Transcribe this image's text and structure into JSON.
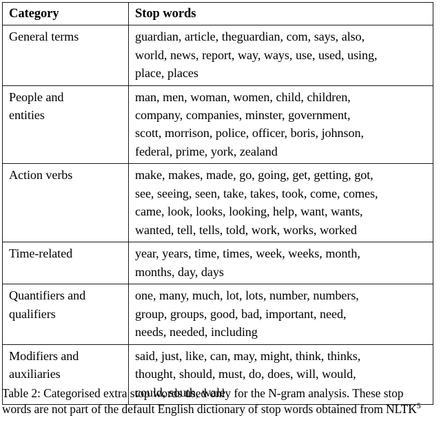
{
  "table": {
    "columns": [
      "Category",
      "Stop words"
    ],
    "rows": [
      {
        "category": "General terms",
        "words": "guardian, article, theguardian, com, says, also,\nworld, news, report, way, ways, use, used, using,\nplace, places"
      },
      {
        "category": "People and\nentities",
        "words": "man, men, woman, women, child, children,\ncompany, companies, minster, government,\nscott, morrison, police, officer, boris, johnson,\nfederal, prime, york, zealand"
      },
      {
        "category": "Action verbs",
        "words": "make, makes, made, go, going, get, getting, got,\nsee, seeing, seen, take, takes, took, come, comes,\ncame, look, looks, looking, help, want, wants,\nwanted, tell, tells, told, work, works, worked"
      },
      {
        "category": "Time-related",
        "words": "year, years, time, times, week, weeks, month,\nmonths, day, days"
      },
      {
        "category": "Quantifiers and\nqualifiers",
        "words": "one, many, much, lot, lots, number, numbers,\ngroup, groups, good, bad, important, need,\nneeds, needed, including"
      },
      {
        "category": "Modifiers and\nauxiliaries",
        "words": "said, just, like, can, may, might, think, thinks,\nthought, should, must, do, does, will, would,\ncould, south, wale"
      }
    ]
  },
  "caption": {
    "text_before_sup": "Table 2: Categorised extra stop words used only for the N-gram analysis. These stop words are not part of the default English dictionary of stop words obtained from NLTK",
    "superscript": "5"
  }
}
